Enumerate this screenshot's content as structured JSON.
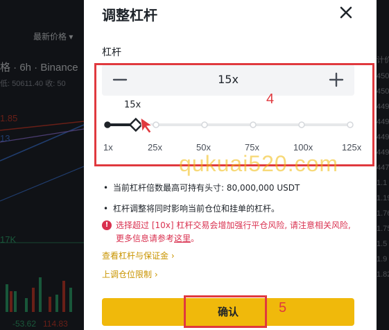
{
  "background": {
    "latest_price_label": "最新价格 ▾",
    "pair_label": "格 · 6h · Binance",
    "price_info": "低: 50611.40  收: 50",
    "left_values": [
      "1.85",
      "13",
      "17K",
      "-53.62",
      "114.83"
    ],
    "right_values": [
      "计价",
      "450",
      "450",
      "449",
      "449",
      "449",
      "449",
      "447",
      "1.1",
      "1.19",
      "1.76",
      "1.75",
      "1.5",
      "1.9",
      "1.82"
    ]
  },
  "dialog": {
    "title": "调整杠杆",
    "section_label": "杠杆",
    "leverage_value": "15x",
    "slider_tip": "15x",
    "slider": {
      "min": 1,
      "max": 125,
      "value": 15,
      "ticks": [
        "1x",
        "25x",
        "50x",
        "75x",
        "100x",
        "125x"
      ]
    },
    "notes": [
      "当前杠杆倍数最高可持有头寸:  80,000,000 USDT",
      "杠杆调整将同时影响当前仓位和挂单的杠杆。"
    ],
    "warning": {
      "icon": "!",
      "text": "选择超过 [10x] 杠杆交易会增加强行平仓风险, 请注意相关风险, 更多信息请参考",
      "link": "这里",
      "end": "。"
    },
    "links": [
      "查看杠杆与保证金 ›",
      "上调仓位限制 ›"
    ],
    "confirm_label": "确认"
  },
  "annotations": {
    "step4": "4",
    "step5": "5",
    "watermark": "qukuai520.com"
  },
  "colors": {
    "accent_yellow": "#f0b90b",
    "warn_red": "#d9304f",
    "annotation_red": "#e0393e",
    "link_gold": "#c99400"
  }
}
